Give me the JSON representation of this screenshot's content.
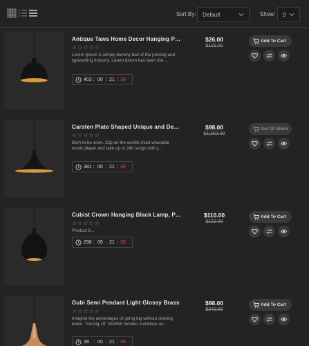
{
  "toolbar": {
    "views": [
      "grid-view-icon",
      "list-view-icon",
      "compact-list-view-icon"
    ],
    "sort_label": "Sort By:",
    "sort_value": "Default",
    "show_label": "Show:",
    "show_value": "9"
  },
  "products": [
    {
      "title": "Antique Tawa Home Decor Hanging Penda...",
      "rating": "☆☆☆☆☆",
      "description": "Lorem Ipsum is simply dummy text of the printing and typesetting industry. Lorem Ipsum has been the ...",
      "countdown": {
        "days": "403",
        "hours": "00",
        "minutes": "21",
        "seconds": "39"
      },
      "price": "$26.00",
      "old_price": "$122.00",
      "cart_label": "Add To Cart"
    },
    {
      "title": "Carsten Plate Shaped Unique and Decorati...",
      "rating": "☆☆☆☆☆",
      "description": "Born to be worn. Clip on the worlds most wearable music player and take up to 240 songs with y...",
      "countdown": {
        "days": "381",
        "hours": "00",
        "minutes": "21",
        "seconds": "39"
      },
      "price": "$98.00",
      "old_price": "$1,202.00",
      "cart_label": "Out Of Stock"
    },
    {
      "title": "Cubist Crown Hanging Black Lamp, Penda...",
      "rating": "☆☆☆☆☆",
      "description": "Product 8...",
      "countdown": {
        "days": "298",
        "hours": "00",
        "minutes": "21",
        "seconds": "39"
      },
      "price": "$110.00",
      "old_price": "$122.00",
      "cart_label": "Add To Cart"
    },
    {
      "title": "Gubi Semi Pendant Light Glossy Brass",
      "rating": "☆☆☆☆☆",
      "description": "Imagine the advantages of going big without slowing down. The big 19\" 941BW monitor combines wi...",
      "countdown": {
        "days": "39",
        "hours": "00",
        "minutes": "21",
        "seconds": "39"
      },
      "price": "$98.00",
      "old_price": "$242.00",
      "cart_label": "Add To Cart"
    }
  ],
  "colors": {
    "background": "#232323",
    "accent_red": "#e2463c",
    "button_bg": "#3a3a3a",
    "lamp_glow": "#d99a3e"
  }
}
